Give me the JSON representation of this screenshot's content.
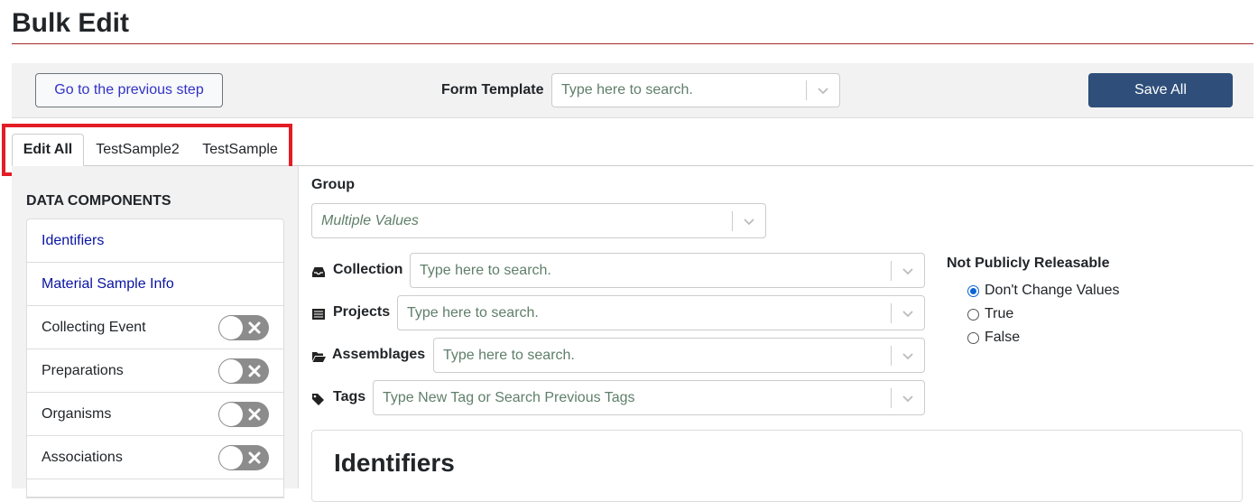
{
  "page": {
    "title": "Bulk Edit"
  },
  "toolbar": {
    "prev_label": "Go to the previous step",
    "template_label": "Form Template",
    "template_placeholder": "Type here to search.",
    "save_label": "Save All"
  },
  "tabs": [
    {
      "label": "Edit All",
      "active": true
    },
    {
      "label": "TestSample2",
      "active": false
    },
    {
      "label": "TestSample",
      "active": false
    }
  ],
  "sidebar": {
    "title": "DATA COMPONENTS",
    "items": [
      {
        "label": "Identifiers",
        "link": true
      },
      {
        "label": "Material Sample Info",
        "link": true
      },
      {
        "label": "Collecting Event",
        "toggle": "off"
      },
      {
        "label": "Preparations",
        "toggle": "off"
      },
      {
        "label": "Organisms",
        "toggle": "off"
      },
      {
        "label": "Associations",
        "toggle": "off"
      }
    ]
  },
  "form": {
    "group": {
      "label": "Group",
      "value": "Multiple Values"
    },
    "collection": {
      "label": "Collection",
      "placeholder": "Type here to search.",
      "icon": "inbox-icon"
    },
    "projects": {
      "label": "Projects",
      "placeholder": "Type here to search.",
      "icon": "list-icon"
    },
    "assemblages": {
      "label": "Assemblages",
      "placeholder": "Type here to search.",
      "icon": "folder-open-icon"
    },
    "tags": {
      "label": "Tags",
      "placeholder": "Type New Tag or Search Previous Tags",
      "icon": "tags-icon"
    },
    "not_public": {
      "label": "Not Publicly Releasable",
      "options": [
        "Don't Change Values",
        "True",
        "False"
      ],
      "selected": "Don't Change Values"
    }
  },
  "card": {
    "title": "Identifiers"
  },
  "colors": {
    "accent": "#2f4f7a",
    "highlight": "#e31c25",
    "title_rule": "#a52a2a",
    "link": "#0a14a0"
  }
}
